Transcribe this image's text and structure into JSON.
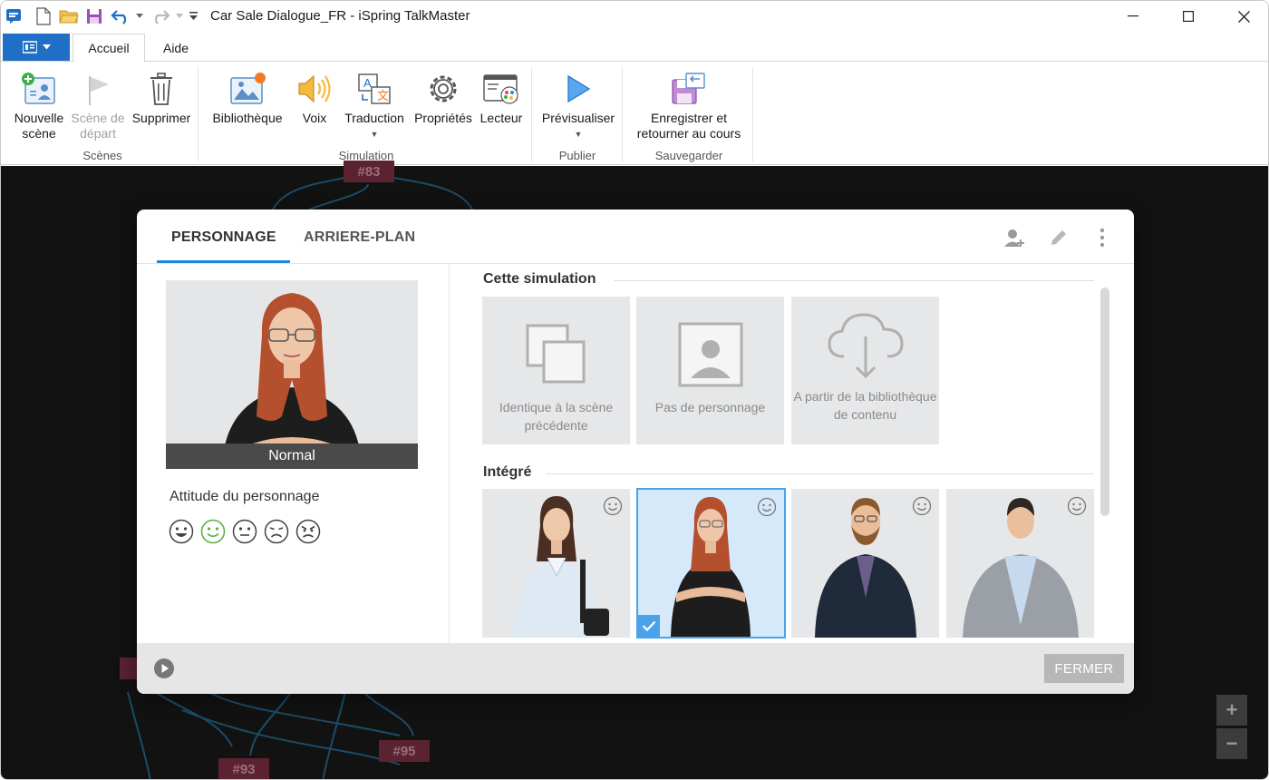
{
  "window": {
    "title": "Car Sale Dialogue_FR - iSpring TalkMaster"
  },
  "colors": {
    "accent": "#1a8ae5",
    "file_button": "#1f6fc6",
    "canvas_bg": "#121212",
    "node_bg": "#5b2232",
    "selected_tile": "#d6e9fb"
  },
  "ribbon": {
    "tabs": [
      {
        "label": "Accueil",
        "active": true
      },
      {
        "label": "Aide",
        "active": false
      }
    ],
    "groups": {
      "scenes": {
        "label": "Scènes",
        "buttons": [
          {
            "label": "Nouvelle scène",
            "icon": "new-scene-icon"
          },
          {
            "label": "Scène de départ",
            "icon": "start-flag-icon",
            "disabled": true
          },
          {
            "label": "Supprimer",
            "icon": "trash-icon"
          }
        ]
      },
      "simulation": {
        "label": "Simulation",
        "buttons": [
          {
            "label": "Bibliothèque",
            "icon": "library-icon"
          },
          {
            "label": "Voix",
            "icon": "speaker-icon"
          },
          {
            "label": "Traduction",
            "icon": "translate-icon"
          },
          {
            "label": "Propriétés",
            "icon": "gear-icon"
          },
          {
            "label": "Lecteur",
            "icon": "player-icon"
          }
        ]
      },
      "publish": {
        "label": "Publier",
        "buttons": [
          {
            "label": "Prévisualiser",
            "icon": "play-icon"
          }
        ]
      },
      "save": {
        "label": "Sauvegarder",
        "buttons": [
          {
            "label": "Enregistrer et retourner au cours",
            "icon": "save-return-icon"
          }
        ]
      }
    }
  },
  "canvas": {
    "nodes": [
      {
        "label": "#83"
      },
      {
        "label": "#93"
      },
      {
        "label": "#95"
      }
    ],
    "zoom_in": "+",
    "zoom_out": "−"
  },
  "dialog": {
    "tabs": [
      {
        "label": "PERSONNAGE",
        "active": true
      },
      {
        "label": "ARRIERE-PLAN",
        "active": false
      }
    ],
    "preview": {
      "label": "Normal"
    },
    "attitude": {
      "label": "Attitude du personnage",
      "options": [
        "happy",
        "smile",
        "neutral",
        "sad",
        "angry"
      ],
      "selected": "smile"
    },
    "sections": {
      "this_simulation": {
        "title": "Cette simulation",
        "tiles": [
          {
            "caption": "Identique à la scène précédente",
            "icon": "duplicate-icon"
          },
          {
            "caption": "Pas de personnage",
            "icon": "no-character-icon"
          },
          {
            "caption": "A partir de la bibliothèque de contenu",
            "icon": "cloud-download-icon"
          }
        ]
      },
      "integrated": {
        "title": "Intégré",
        "characters": [
          {
            "name": "woman-blue-shirt",
            "selected": false
          },
          {
            "name": "woman-red-hair",
            "selected": true
          },
          {
            "name": "man-beard-suit",
            "selected": false
          },
          {
            "name": "man-grey-blazer",
            "selected": false
          }
        ]
      }
    },
    "footer": {
      "close_label": "FERMER"
    }
  }
}
